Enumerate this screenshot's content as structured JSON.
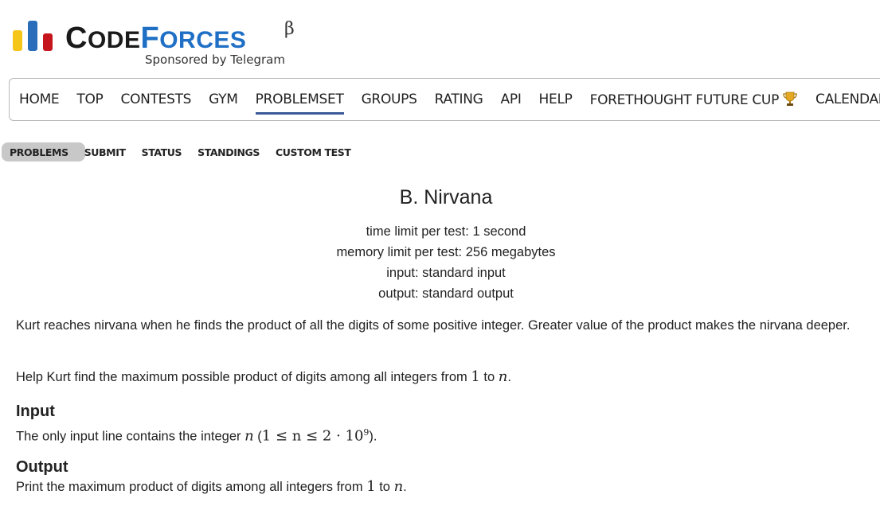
{
  "logo": {
    "code_first": "C",
    "code_rest": "ODE",
    "forces_first": "F",
    "forces_rest": "ORCES",
    "beta": "β",
    "sponsor": "Sponsored by Telegram",
    "bar_colors": [
      "#f5c518",
      "#2a6ebb",
      "#c4161c"
    ]
  },
  "main_menu": {
    "items": [
      {
        "label": "HOME"
      },
      {
        "label": "TOP"
      },
      {
        "label": "CONTESTS"
      },
      {
        "label": "GYM"
      },
      {
        "label": "PROBLEMSET",
        "selected": true
      },
      {
        "label": "GROUPS"
      },
      {
        "label": "RATING"
      },
      {
        "label": "API"
      },
      {
        "label": "HELP"
      },
      {
        "label": "FORETHOUGHT FUTURE CUP",
        "icon": "trophy-icon"
      },
      {
        "label": "CALENDAR"
      }
    ],
    "accent": "#3b5998"
  },
  "second_menu": {
    "items": [
      {
        "label": "PROBLEMS",
        "selected": true
      },
      {
        "label": "SUBMIT"
      },
      {
        "label": "STATUS"
      },
      {
        "label": "STANDINGS"
      },
      {
        "label": "CUSTOM TEST"
      }
    ]
  },
  "problem": {
    "title": "B. Nirvana",
    "time_limit": "time limit per test: 1 second",
    "memory_limit": "memory limit per test: 256 megabytes",
    "input": "input: standard input",
    "output": "output: standard output",
    "legend_p1": "Kurt reaches nirvana when he finds the product of all the digits of some positive integer. Greater value of the product makes the nirvana deeper.",
    "legend_p2_a": "Help Kurt find the maximum possible product of digits among all integers from ",
    "legend_p2_m1": "1",
    "legend_p2_b": " to ",
    "legend_p2_m2": "n",
    "legend_p2_c": ".",
    "input_title": "Input",
    "input_a": "The only input line contains the integer ",
    "input_m1": "n",
    "input_b": " (",
    "input_m2": "1 ≤ n ≤ 2 · 10",
    "input_sup": "9",
    "input_c": ").",
    "output_title": "Output",
    "output_a": "Print the maximum product of digits among all integers from ",
    "output_m1": "1",
    "output_b": " to ",
    "output_m2": "n",
    "output_c": "."
  }
}
